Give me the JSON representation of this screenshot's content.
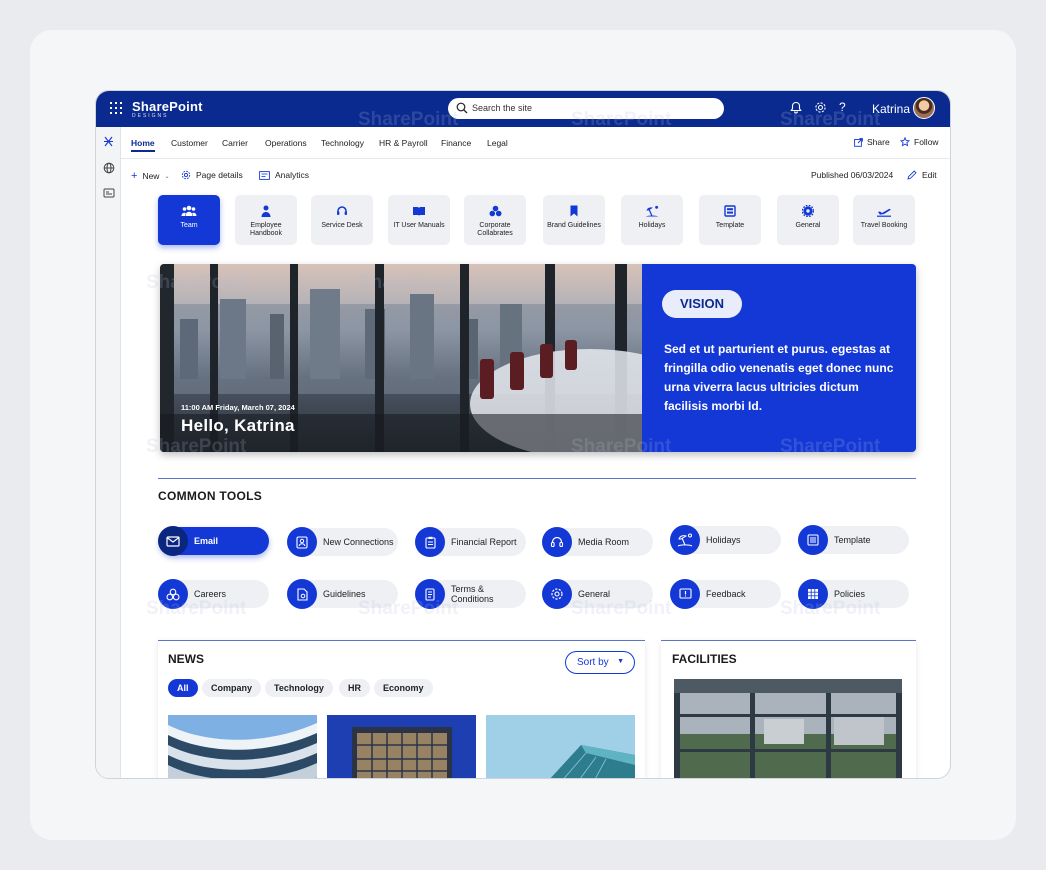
{
  "app": {
    "logo_text": "SharePoint",
    "logo_sub": "DESIGNS",
    "search_placeholder": "Search the site",
    "user_name": "Katrina"
  },
  "nav": {
    "links": [
      "Home",
      "Customer",
      "Carrier",
      "Operations",
      "Technology",
      "HR & Payroll",
      "Finance",
      "Legal"
    ],
    "share": "Share",
    "follow": "Follow"
  },
  "cmdbar": {
    "new": "New",
    "page_details": "Page details",
    "analytics": "Analytics",
    "published": "Published 06/03/2024",
    "edit": "Edit"
  },
  "quicklinks": [
    {
      "label": "Team",
      "icon": "team-icon"
    },
    {
      "label": "Employee Handbook",
      "icon": "person-icon"
    },
    {
      "label": "Service Desk",
      "icon": "headset-icon"
    },
    {
      "label": "IT User Manuals",
      "icon": "book-icon"
    },
    {
      "label": "Corporate Collabrates",
      "icon": "circles-icon"
    },
    {
      "label": "Brand Guidelines",
      "icon": "bookmark-icon"
    },
    {
      "label": "Holidays",
      "icon": "beach-icon"
    },
    {
      "label": "Template",
      "icon": "template-icon"
    },
    {
      "label": "General",
      "icon": "gear-icon"
    },
    {
      "label": "Travel Booking",
      "icon": "plane-icon"
    }
  ],
  "hero": {
    "timestamp": "11:00 AM Friday, March 07, 2024",
    "greeting": "Hello, Katrina",
    "vision_label": "VISION",
    "vision_text": "Sed et ut parturient et purus. egestas at fringilla odio venenatis eget donec nunc urna viverra lacus ultricies dictum facilisis morbi Id."
  },
  "common_tools": {
    "title": "COMMON TOOLS",
    "items": [
      {
        "label": "Email",
        "icon": "mail-icon"
      },
      {
        "label": "New Connections",
        "icon": "contact-icon"
      },
      {
        "label": "Financial Report",
        "icon": "clipboard-icon"
      },
      {
        "label": "Media Room",
        "icon": "headset-icon"
      },
      {
        "label": "Holidays",
        "icon": "beach-icon"
      },
      {
        "label": "Template",
        "icon": "template-icon"
      },
      {
        "label": "Careers",
        "icon": "circles-icon"
      },
      {
        "label": "Guidelines",
        "icon": "document-icon"
      },
      {
        "label": "Terms & Conditions",
        "icon": "terms-icon"
      },
      {
        "label": "General",
        "icon": "gear-icon"
      },
      {
        "label": "Feedback",
        "icon": "feedback-icon"
      },
      {
        "label": "Policies",
        "icon": "grid-icon"
      }
    ]
  },
  "news": {
    "title": "NEWS",
    "sort_label": "Sort by",
    "filters": [
      "All",
      "Company",
      "Technology",
      "HR",
      "Economy"
    ]
  },
  "facilities": {
    "title": "FACILITIES"
  },
  "colors": {
    "suitebar": "#0b2a8f",
    "accent": "#1338d6",
    "tile_bg": "#eef0f4"
  }
}
